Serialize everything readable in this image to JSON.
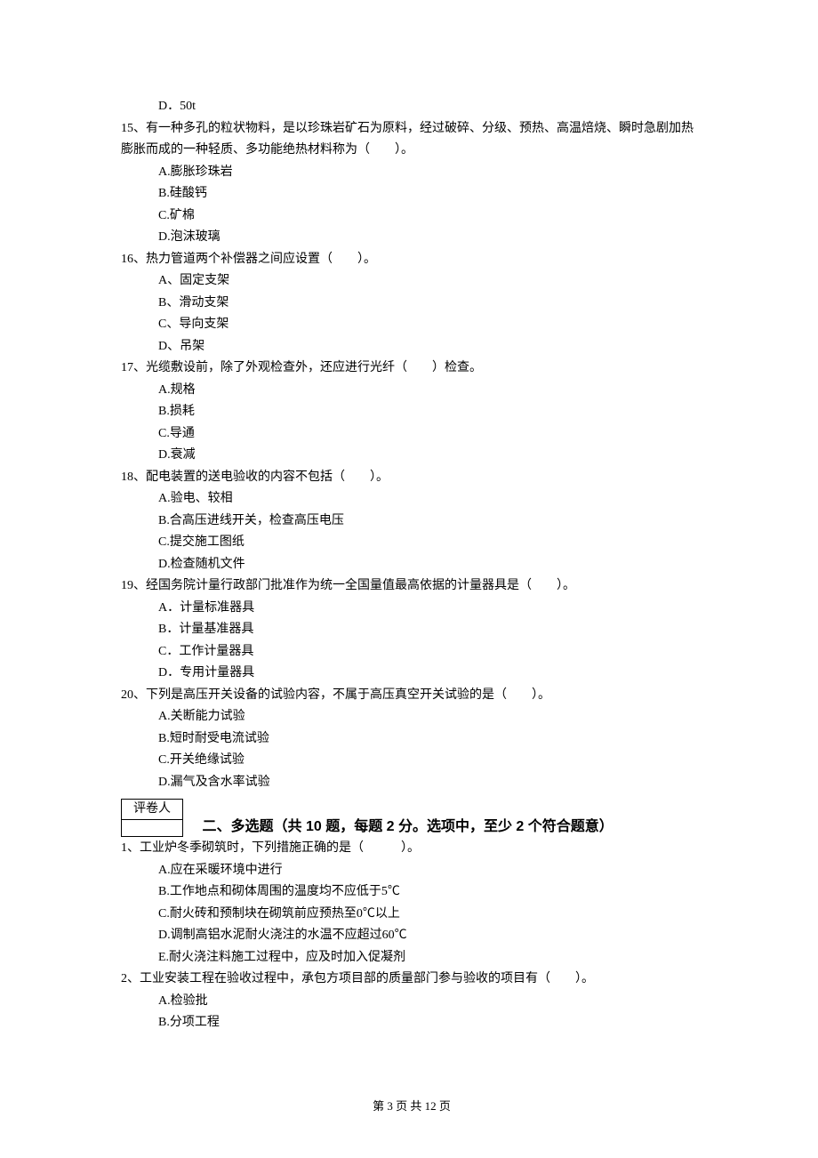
{
  "leading_option": "D．50t",
  "questions": [
    {
      "num": "15",
      "stem": "15、有一种多孔的粒状物料，是以珍珠岩矿石为原料，经过破碎、分级、预热、高温焙烧、瞬时急剧加热膨胀而成的一种轻质、多功能绝热材料称为（　　）。",
      "options": [
        "A.膨胀珍珠岩",
        "B.硅酸钙",
        "C.矿棉",
        "D.泡沫玻璃"
      ]
    },
    {
      "num": "16",
      "stem": "16、热力管道两个补偿器之间应设置（　　）。",
      "options": [
        "A、固定支架",
        "B、滑动支架",
        "C、导向支架",
        "D、吊架"
      ]
    },
    {
      "num": "17",
      "stem": "17、光缆敷设前，除了外观检查外，还应进行光纤（　　）检查。",
      "options": [
        "A.规格",
        "B.损耗",
        "C.导通",
        "D.衰减"
      ]
    },
    {
      "num": "18",
      "stem": "18、配电装置的送电验收的内容不包括（　　）。",
      "options": [
        "A.验电、较相",
        "B.合高压进线开关，检查高压电压",
        "C.提交施工图纸",
        "D.检查随机文件"
      ]
    },
    {
      "num": "19",
      "stem": "19、经国务院计量行政部门批准作为统一全国量值最高依据的计量器具是（　　）。",
      "options": [
        "A．计量标准器具",
        "B．计量基准器具",
        "C．工作计量器具",
        "D．专用计量器具"
      ]
    },
    {
      "num": "20",
      "stem": "20、下列是高压开关设备的试验内容，不属于高压真空开关试验的是（　　）。",
      "options": [
        "A.关断能力试验",
        "B.短时耐受电流试验",
        "C.开关绝缘试验",
        "D.漏气及含水率试验"
      ]
    }
  ],
  "grader_label": "评卷人",
  "section_title": "二、多选题（共 10 题，每题 2 分。选项中，至少 2 个符合题意）",
  "section2_questions": [
    {
      "num": "1",
      "stem": "1、工业炉冬季砌筑时，下列措施正确的是（　　　）。",
      "options": [
        "A.应在采暖环境中进行",
        "B.工作地点和砌体周围的温度均不应低于5℃",
        "C.耐火砖和预制块在砌筑前应预热至0℃以上",
        "D.调制高铝水泥耐火浇注的水温不应超过60℃",
        "E.耐火浇注料施工过程中，应及时加入促凝剂"
      ]
    },
    {
      "num": "2",
      "stem": "2、工业安装工程在验收过程中，承包方项目部的质量部门参与验收的项目有（　　）。",
      "options": [
        "A.检验批",
        "B.分项工程"
      ]
    }
  ],
  "footer": "第 3 页 共 12 页"
}
